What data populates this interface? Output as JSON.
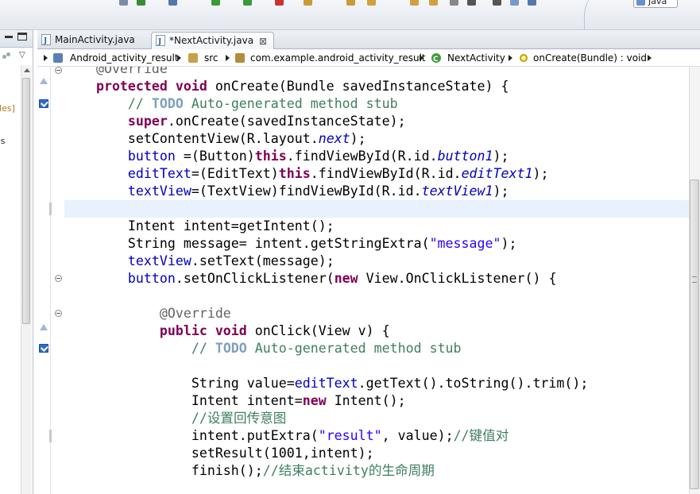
{
  "toolbar": {
    "perspective_label": "Java",
    "icons": [
      "new-icon",
      "save-icon",
      "print-icon",
      "run-icon",
      "debug-icon",
      "external-tools-icon",
      "new-package-icon",
      "new-class-icon",
      "open-type-icon",
      "search-icon",
      "next-annotation-icon",
      "prev-annotation-icon",
      "back-icon",
      "forward-icon",
      "pin-icon",
      "perspective-icon"
    ],
    "icon_colors": [
      "#7a8da8",
      "#3a8a3a",
      "#5577aa",
      "#3a9a3a",
      "#3a9a3a",
      "#cc3333",
      "#c89a3a",
      "#c89a3a",
      "#d0a040",
      "#d0a040",
      "#d0a040",
      "#888888",
      "#555555",
      "#555555",
      "#7799cc",
      "#5577aa"
    ]
  },
  "left_panel": {
    "text1": "iles]",
    "text2": "es",
    "text3": "s"
  },
  "editor_tabs": [
    {
      "label": "MainActivity.java",
      "active": false
    },
    {
      "label": "*NextActivity.java",
      "active": true,
      "close": "⊠"
    }
  ],
  "breadcrumb": [
    {
      "label": "Android_activity_result",
      "icon": "project-icon"
    },
    {
      "label": "src",
      "icon": "source-folder-icon"
    },
    {
      "label": "com.example.android_activity_result",
      "icon": "package-icon"
    },
    {
      "label": "NextActivity",
      "icon": "class-icon"
    },
    {
      "label": "onCreate(Bundle) : void",
      "icon": "method-icon"
    }
  ],
  "code": {
    "current_line_index": 7,
    "lines": [
      [
        [
          "ann",
          "    @Override"
        ]
      ],
      [
        [
          "kw",
          "    protected void"
        ],
        [
          "p",
          " onCreate(Bundle savedInstanceState) {"
        ]
      ],
      [
        [
          "cm",
          "        // "
        ],
        [
          "todo",
          "TODO"
        ],
        [
          "cm",
          " Auto-generated method stub"
        ]
      ],
      [
        [
          "kw",
          "        super"
        ],
        [
          "p",
          ".onCreate(savedInstanceState);"
        ]
      ],
      [
        [
          "p",
          "        setContentView(R.layout."
        ],
        [
          "sfld",
          "next"
        ],
        [
          "p",
          ");"
        ]
      ],
      [
        [
          "fld",
          "        button"
        ],
        [
          "p",
          " =(Button)"
        ],
        [
          "kw",
          "this"
        ],
        [
          "p",
          ".findViewById(R.id."
        ],
        [
          "sfld",
          "button1"
        ],
        [
          "p",
          ");"
        ]
      ],
      [
        [
          "fld",
          "        editText"
        ],
        [
          "p",
          "=(EditText)"
        ],
        [
          "kw",
          "this"
        ],
        [
          "p",
          ".findViewById(R.id."
        ],
        [
          "sfld",
          "editText1"
        ],
        [
          "p",
          ");"
        ]
      ],
      [
        [
          "fld",
          "        textView"
        ],
        [
          "p",
          "=(TextView)findViewById(R.id."
        ],
        [
          "sfld",
          "textView1"
        ],
        [
          "p",
          ");"
        ]
      ],
      [
        [
          "p",
          ""
        ]
      ],
      [
        [
          "p",
          "        Intent intent=getIntent();"
        ]
      ],
      [
        [
          "p",
          "        String message= intent.getStringExtra("
        ],
        [
          "str",
          "\"message\""
        ],
        [
          "p",
          ");"
        ]
      ],
      [
        [
          "fld",
          "        textView"
        ],
        [
          "p",
          ".setText(message);"
        ]
      ],
      [
        [
          "fld",
          "        button"
        ],
        [
          "p",
          ".setOnClickListener("
        ],
        [
          "kw",
          "new"
        ],
        [
          "p",
          " View.OnClickListener() {"
        ]
      ],
      [
        [
          "p",
          ""
        ]
      ],
      [
        [
          "ann",
          "            @Override"
        ]
      ],
      [
        [
          "kw",
          "            public void"
        ],
        [
          "p",
          " onClick(View v) {"
        ]
      ],
      [
        [
          "cm",
          "                // "
        ],
        [
          "todo",
          "TODO"
        ],
        [
          "cm",
          " Auto-generated method stub"
        ]
      ],
      [
        [
          "p",
          ""
        ]
      ],
      [
        [
          "p",
          "                String value="
        ],
        [
          "fld",
          "editText"
        ],
        [
          "p",
          ".getText().toString().trim();"
        ]
      ],
      [
        [
          "p",
          "                Intent intent="
        ],
        [
          "kw",
          "new"
        ],
        [
          "p",
          " Intent();"
        ]
      ],
      [
        [
          "cm",
          "                //设置回传意图"
        ]
      ],
      [
        [
          "p",
          "                intent.putExtra("
        ],
        [
          "str",
          "\"result\""
        ],
        [
          "p",
          ", value);"
        ],
        [
          "cm",
          "//键值对"
        ]
      ],
      [
        [
          "p",
          "                setResult(1001,intent);"
        ]
      ],
      [
        [
          "p",
          "                finish();"
        ],
        [
          "cm",
          "//结束activity的生命周期"
        ]
      ]
    ]
  }
}
